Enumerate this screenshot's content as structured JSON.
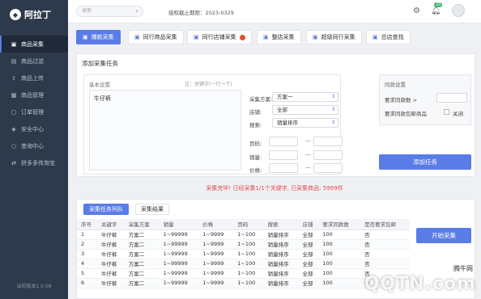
{
  "app": {
    "name": "阿拉丁",
    "version": "当前版本1.0.08"
  },
  "sidebar": {
    "items": [
      {
        "label": "商品采集",
        "icon": "box-icon"
      },
      {
        "label": "商品过滤",
        "icon": "filter-icon"
      },
      {
        "label": "商品上传",
        "icon": "upload-icon"
      },
      {
        "label": "商品管理",
        "icon": "grid-icon"
      },
      {
        "label": "订单管理",
        "icon": "order-icon"
      },
      {
        "label": "安全中心",
        "icon": "shield-icon"
      },
      {
        "label": "查询中心",
        "icon": "search-icon"
      },
      {
        "label": "拼多多传淘宝",
        "icon": "transfer-icon"
      }
    ]
  },
  "topbar": {
    "search_placeholder": "搜索",
    "expire_label": "授权截止期限：2023-0329",
    "notification_count": "20"
  },
  "tabs": [
    {
      "label": "爆款采集"
    },
    {
      "label": "同行商品采集"
    },
    {
      "label": "同行店铺采集"
    },
    {
      "label": "整店采集"
    },
    {
      "label": "超级同行采集"
    },
    {
      "label": "总店查找"
    }
  ],
  "task_panel": {
    "title": "添加采集任务",
    "basic_title": "基本设置",
    "basic_note": "注：关键字(一行一个)",
    "keyword_value": "牛仔裤",
    "scheme_label": "采集方案:",
    "scheme_value": "方案一",
    "store_label": "店铺:",
    "store_value": "全部",
    "search_label": "搜索:",
    "search_value": "销量排序",
    "page_label": "页码:",
    "sales_label": "销量:",
    "price_label": "价格:",
    "range_dash": "—",
    "same_title": "同款设置",
    "same_count_label": "要求同款数 >",
    "same_free_label": "要求同款包邮商品",
    "same_close_label": "关闭",
    "add_button": "添加任务"
  },
  "status_message": "采集完毕! 已经采集1/1个关键字, 已采集商品: 5999件",
  "results": {
    "tab_queue": "采集任务列队",
    "tab_result": "采集结果",
    "start_button": "开始采集",
    "columns": [
      "序号",
      "关键字",
      "采集方案",
      "销量",
      "价格",
      "页码",
      "搜索",
      "店铺",
      "要求同款数",
      "是否要求包邮"
    ],
    "rows": [
      [
        "1",
        "牛仔裤",
        "方案二",
        "1~99999",
        "1~9999",
        "1~100",
        "销量排序",
        "全部",
        "100",
        "否"
      ],
      [
        "2",
        "牛仔裤",
        "方案二",
        "1~99999",
        "1~9999",
        "1~100",
        "销量排序",
        "全部",
        "100",
        "否"
      ],
      [
        "3",
        "牛仔裤",
        "方案二",
        "1~99999",
        "1~9999",
        "1~100",
        "销量排序",
        "全部",
        "100",
        "否"
      ],
      [
        "4",
        "牛仔裤",
        "方案二",
        "1~99999",
        "1~9999",
        "1~100",
        "销量排序",
        "全部",
        "100",
        "否"
      ],
      [
        "5",
        "牛仔裤",
        "方案二",
        "1~99999",
        "1~9999",
        "1~100",
        "销量排序",
        "全部",
        "100",
        "否"
      ],
      [
        "6",
        "牛仔裤",
        "方案二",
        "1~99999",
        "1~9999",
        "1~100",
        "销量排序",
        "全部",
        "100",
        "否"
      ]
    ]
  },
  "watermark": {
    "top": "腾牛网",
    "main": "QQTN.com"
  },
  "colors": {
    "accent": "#5a7ce6",
    "sidebar": "#2d3a4b",
    "alert": "#e34a4a"
  }
}
